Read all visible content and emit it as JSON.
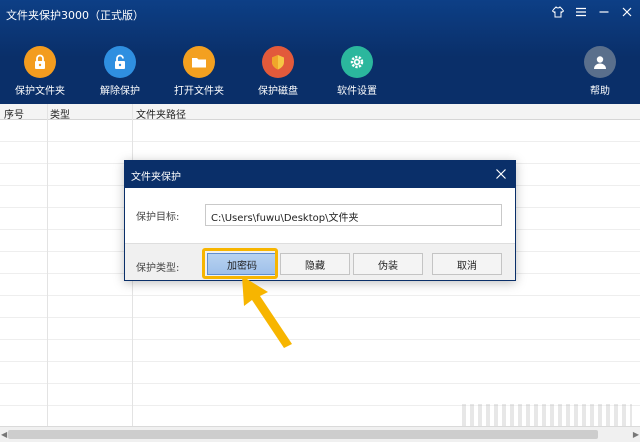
{
  "app": {
    "title": "文件夹保护3000（正式版）"
  },
  "toolbar": {
    "items": [
      {
        "label": "保护文件夹",
        "icon": "lock-icon",
        "color": "#f39c1f"
      },
      {
        "label": "解除保护",
        "icon": "unlock-icon",
        "color": "#2f8fe0"
      },
      {
        "label": "打开文件夹",
        "icon": "folder-icon",
        "color": "#f3a020"
      },
      {
        "label": "保护磁盘",
        "icon": "shield-icon",
        "color": "#e25a3b"
      },
      {
        "label": "软件设置",
        "icon": "gear-icon",
        "color": "#2bb79d"
      }
    ],
    "help_label": "帮助"
  },
  "table": {
    "columns": [
      "序号",
      "类型",
      "文件夹路径"
    ]
  },
  "dialog": {
    "title": "文件夹保护",
    "target_label": "保护目标:",
    "target_value": "C:\\Users\\fuwu\\Desktop\\文件夹",
    "type_label": "保护类型:",
    "buttons": [
      "加密码",
      "隐藏",
      "伪装",
      "取消"
    ]
  },
  "colors": {
    "header": "#0a2f69",
    "highlight": "#f7b500"
  }
}
